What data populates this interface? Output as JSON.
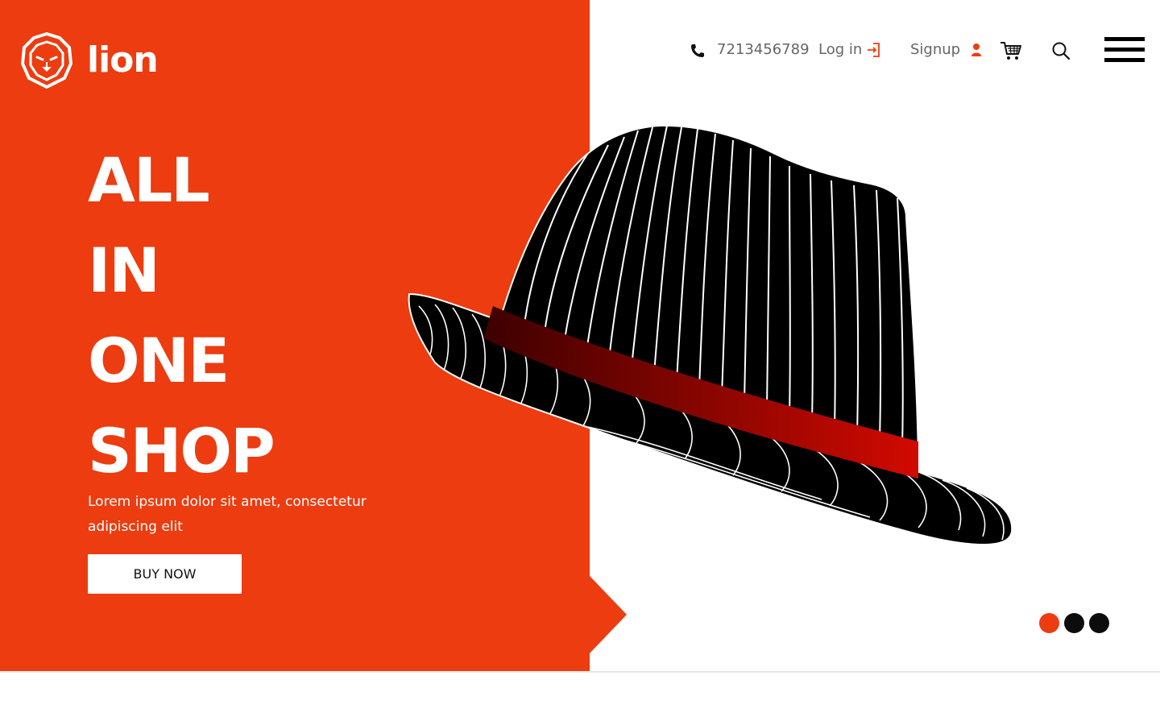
{
  "brand": {
    "name": "lion",
    "logo_icon": "lion-head-icon"
  },
  "header": {
    "phone": "7213456789",
    "login_label": "Log in",
    "signup_label": "Signup",
    "icons": [
      "phone-icon",
      "login-icon",
      "user-icon",
      "cart-icon",
      "search-icon",
      "hamburger-menu-icon"
    ]
  },
  "hero": {
    "headline": [
      "ALL",
      "IN",
      "ONE",
      "SHOP"
    ],
    "description": "Lorem ipsum dolor sit amet, consectetur adipiscing elit",
    "cta_label": "BUY NOW",
    "image": "striped-fedora-hat"
  },
  "carousel": {
    "slides": 3,
    "active_index": 0,
    "dot_colors": [
      "#ec3c10",
      "#0c0c0c",
      "#0c0c0c"
    ]
  },
  "colors": {
    "accent": "#ec3c10",
    "dark": "#000000",
    "light": "#ffffff",
    "hat_band": "#d10a00"
  }
}
